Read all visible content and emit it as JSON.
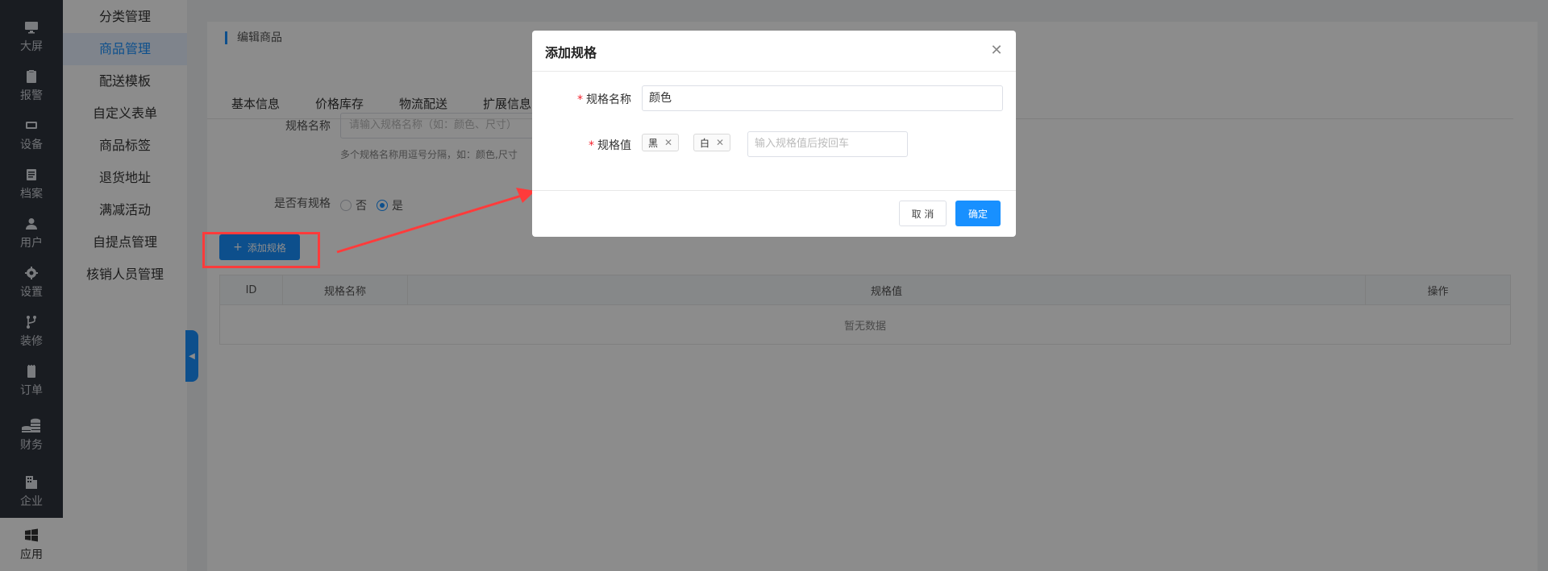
{
  "nav": {
    "items": [
      {
        "label": "大屏",
        "icon": "monitor-icon"
      },
      {
        "label": "报警",
        "icon": "clipboard-icon"
      },
      {
        "label": "设备",
        "icon": "device-icon"
      },
      {
        "label": "档案",
        "icon": "document-icon"
      },
      {
        "label": "用户",
        "icon": "user-icon"
      },
      {
        "label": "设置",
        "icon": "gear-icon"
      },
      {
        "label": "装修",
        "icon": "branch-icon"
      },
      {
        "label": "订单",
        "icon": "order-icon"
      },
      {
        "label": "财务",
        "icon": "finance-icon"
      },
      {
        "label": "企业",
        "icon": "building-icon"
      },
      {
        "label": "应用",
        "icon": "windows-icon"
      }
    ],
    "active": "应用"
  },
  "submenu": {
    "items": [
      "分类管理",
      "商品管理",
      "配送模板",
      "自定义表单",
      "商品标签",
      "退货地址",
      "满减活动",
      "自提点管理",
      "核销人员管理"
    ],
    "active": "商品管理"
  },
  "page": {
    "title": "编辑商品",
    "tabs": [
      "基本信息",
      "价格库存",
      "物流配送",
      "扩展信息"
    ],
    "spec_name_label": "规格名称",
    "spec_name_placeholder": "请输入规格名称（如：颜色、尺寸）",
    "spec_hint": "多个规格名称用逗号分隔，如：颜色,尺寸",
    "has_spec_label": "是否有规格",
    "radio_no": "否",
    "radio_yes": "是",
    "has_spec_value": "是",
    "add_spec_button": "添加规格",
    "table": {
      "columns": [
        "ID",
        "规格名称",
        "规格值",
        "操作"
      ],
      "empty_text": "暂无数据"
    }
  },
  "modal": {
    "title": "添加规格",
    "name_label": "规格名称",
    "name_value": "颜色",
    "values_label": "规格值",
    "tags": [
      "黑",
      "白"
    ],
    "values_placeholder": "输入规格值后按回车",
    "cancel": "取 消",
    "ok": "确定"
  },
  "colors": {
    "primary": "#1890ff",
    "annotation": "#ff3b3b",
    "nav_bg": "#2f343d"
  }
}
